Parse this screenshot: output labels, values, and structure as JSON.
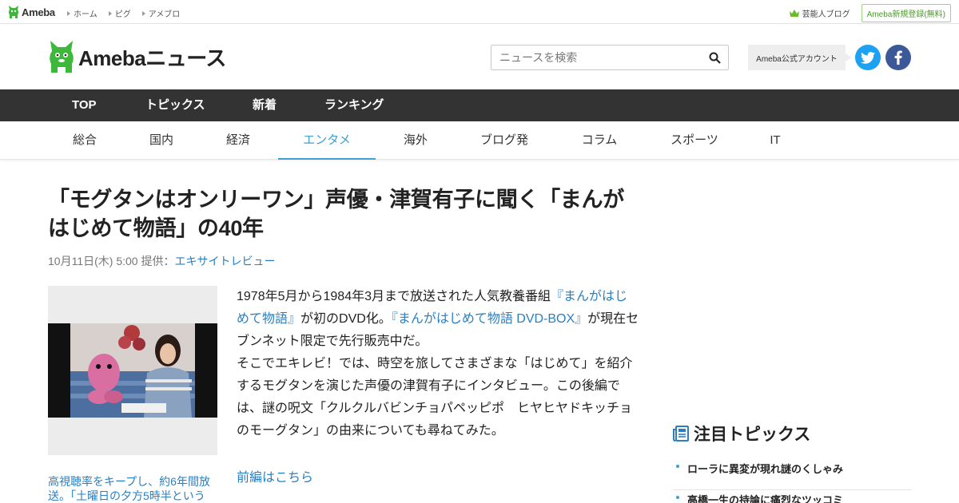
{
  "topbar": {
    "brand": "Ameba",
    "links": [
      "ホーム",
      "ピグ",
      "アメブロ"
    ],
    "geinou": "芸能人ブログ",
    "register": "Ameba新規登録(無料)"
  },
  "header": {
    "logo_text": "Amebaニュース",
    "search_placeholder": "ニュースを検索",
    "official_label": "Ameba公式アカウント"
  },
  "main_nav": [
    "TOP",
    "トピックス",
    "新着",
    "ランキング"
  ],
  "sub_nav": {
    "items": [
      "総合",
      "国内",
      "経済",
      "エンタメ",
      "海外",
      "ブログ発",
      "コラム",
      "スポーツ",
      "IT"
    ],
    "active": "エンタメ"
  },
  "article": {
    "title": "「モグタンはオンリーワン」声優・津賀有子に聞く「まんがはじめて物語」の40年",
    "date": "10月11日(木) 5:00",
    "provider_label": "提供：",
    "provider": "エキサイトレビュー",
    "caption": "高視聴率をキープし、約6年間放送。「土曜日の夕方5時半という",
    "body": {
      "p1_a": "1978年5月から1984年3月まで放送された人気教養番組",
      "p1_link1": "『まんがはじめて物語』",
      "p1_b": "が初のDVD化。",
      "p1_link2": "『まんがはじめて物語 DVD-BOX』",
      "p1_c": "が現在セブンネット限定で先行販売中だ。",
      "p2": "そこでエキレビ！では、時空を旅してさまざまな「はじめて」を紹介するモグタンを演じた声優の津賀有子にインタビュー。この後編では、謎の呪文「クルクルバビンチョパペッピポ　ヒヤヒヤドキッチョのモーグタン」の由来についても尋ねてみた。"
    },
    "more_link": "前編はこちら"
  },
  "sidebar": {
    "topics_title": "注目トピックス",
    "topics": [
      "ローラに異変が現れ謎のくしゃみ",
      "高橋一生の持論に痛烈なツッコミ"
    ]
  },
  "colors": {
    "accent": "#3aa0d6",
    "link": "#2a7fc1",
    "nav_bg": "#333333",
    "brand_green": "#3db83a"
  }
}
